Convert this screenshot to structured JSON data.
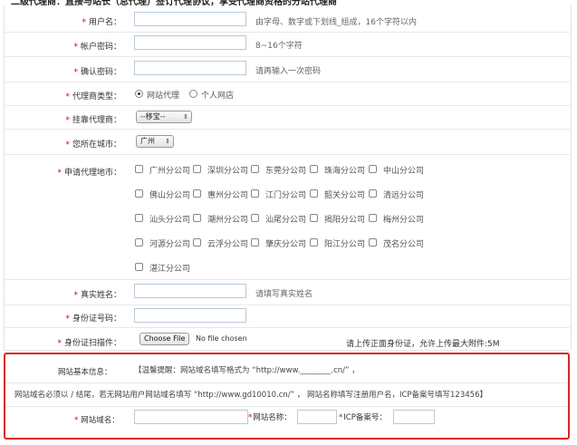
{
  "top_cut_text": "二级代理商：直接与站长（总代理）签订代理协议，享受代理商资格的分站代理商",
  "form": {
    "username": {
      "label": "用户名：",
      "hint": "由字母、数字或下划线_组成，16个字符以内"
    },
    "password": {
      "label": "帐户密码：",
      "hint": "8~16个字符"
    },
    "confirm_password": {
      "label": "确认密码：",
      "hint": "请再输入一次密码"
    },
    "agent_type": {
      "label": "代理商类型：",
      "options": [
        "网站代理",
        "个人网店"
      ],
      "selected": "网站代理"
    },
    "parent_agent": {
      "label": "挂靠代理商：",
      "selected": "--移宝--"
    },
    "city": {
      "label": "您所在城市：",
      "selected": "广州"
    },
    "apply_areas": {
      "label": "申请代理地市：",
      "items": [
        "广州分公司",
        "深圳分公司",
        "东莞分公司",
        "珠海分公司",
        "中山分公司",
        "佛山分公司",
        "惠州分公司",
        "江门分公司",
        "韶关分公司",
        "清远分公司",
        "汕头分公司",
        "潮州分公司",
        "汕尾分公司",
        "揭阳分公司",
        "梅州分公司",
        "河源分公司",
        "云浮分公司",
        "肇庆分公司",
        "阳江分公司",
        "茂名分公司",
        "湛江分公司"
      ]
    },
    "real_name": {
      "label": "真实姓名：",
      "hint": "请填写真实姓名"
    },
    "id_number": {
      "label": "身份证号码："
    },
    "id_scan": {
      "label": "身份证扫描件：",
      "button": "Choose File",
      "file_status": "No file chosen",
      "hint": "请上传正面身份证，允许上传最大附件:5M"
    }
  },
  "site_info": {
    "label": "网站基本信息：",
    "tip": "【温馨提醒：网站域名填写格式为 “http://www.________.cn/” ，",
    "note": "网站域名必须以 / 结尾，若无网站用户网站域名填写 “http://www.gd10010.cn/” ，    网站名称填写注册用户名，ICP备案号填写123456】",
    "domain_label": "网站域名：",
    "name_label": "网站名称：",
    "icp_label": "ICP备案号："
  }
}
